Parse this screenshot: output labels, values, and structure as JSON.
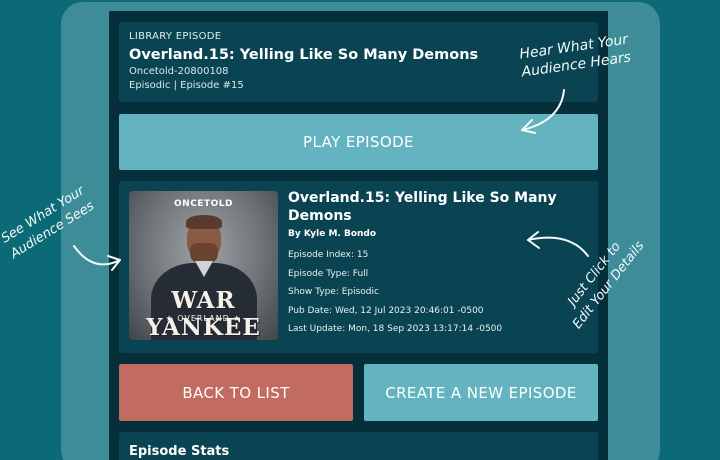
{
  "episode_header": {
    "eyebrow": "LIBRARY EPISODE",
    "title": "Overland.15: Yelling Like So Many Demons",
    "code": "Oncetold-20800108",
    "type_line": "Episodic | Episode #15"
  },
  "buttons": {
    "play": "PLAY EPISODE",
    "back": "BACK TO LIST",
    "create": "CREATE A NEW EPISODE"
  },
  "details": {
    "cover": {
      "brand": "ONCETOLD",
      "title": "WAR YANKEE",
      "subtitle": "★ OVERLAND ★"
    },
    "title": "Overland.15: Yelling Like So Many Demons",
    "author": "By Kyle M. Bondo",
    "lines": [
      "Episode Index: 15",
      "Episode Type: Full",
      "Show Type: Episodic",
      "Pub Date: Wed, 12 Jul 2023 20:46:01 -0500",
      "Last Update: Mon, 18 Sep 2023 13:17:14 -0500"
    ]
  },
  "stats": {
    "title": "Episode Stats"
  },
  "annotations": {
    "hear_line1": "Hear What Your",
    "hear_line2": "Audience Hears",
    "see_line1": "See What Your",
    "see_line2": "Audience Sees",
    "click_line1": "Just Click to",
    "click_line2": "Edit Your Details"
  },
  "colors": {
    "background": "#0b6a76",
    "frame": "#3e8c98",
    "panel": "#052f3a",
    "card": "#0a4452",
    "primary_button": "#64b3c0",
    "danger_button": "#c16b61"
  }
}
